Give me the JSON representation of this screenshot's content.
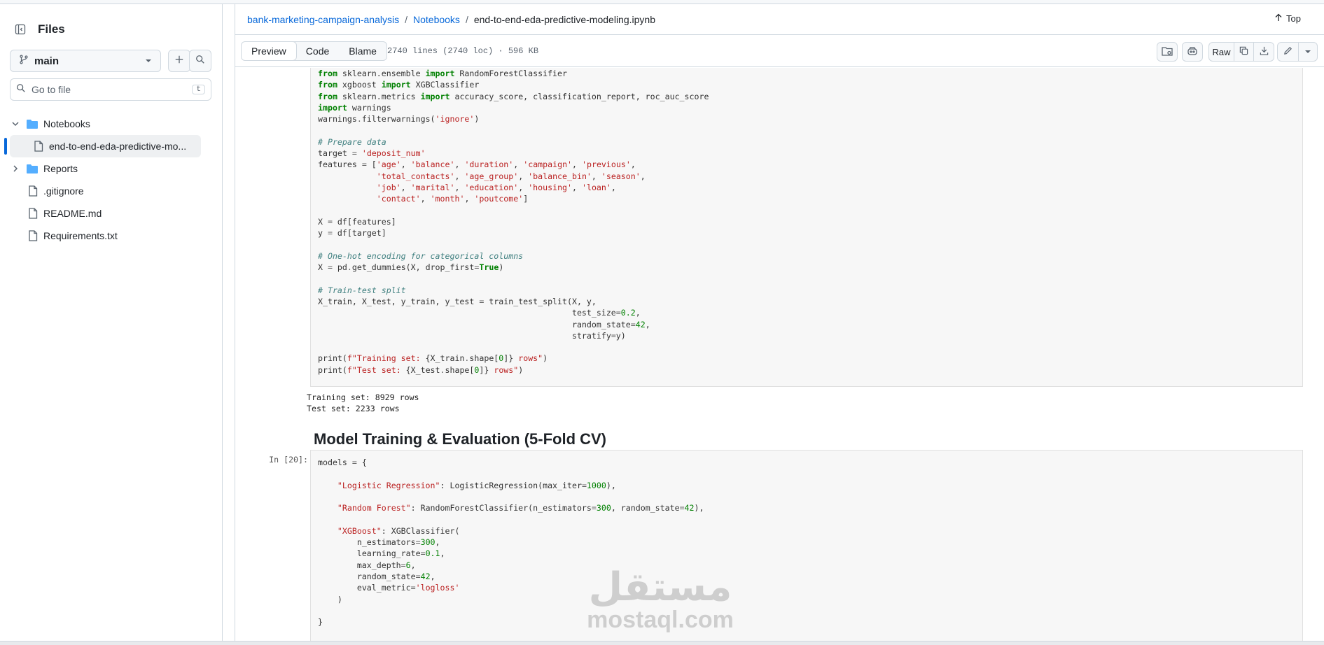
{
  "sidebar": {
    "title": "Files",
    "branch": "main",
    "search_placeholder": "Go to file",
    "search_shortcut": "t",
    "tree": [
      {
        "label": "Notebooks",
        "type": "folder",
        "expanded": true
      },
      {
        "label": "end-to-end-eda-predictive-mo...",
        "type": "file",
        "selected": true
      },
      {
        "label": "Reports",
        "type": "folder",
        "expanded": false
      },
      {
        "label": ".gitignore",
        "type": "file"
      },
      {
        "label": "README.md",
        "type": "file"
      },
      {
        "label": "Requirements.txt",
        "type": "file"
      }
    ]
  },
  "breadcrumb": {
    "repo": "bank-marketing-campaign-analysis",
    "folder": "Notebooks",
    "file": "end-to-end-eda-predictive-modeling.ipynb",
    "top_label": "Top"
  },
  "toolbar": {
    "tabs": [
      "Preview",
      "Code",
      "Blame"
    ],
    "active_tab": "Preview",
    "file_meta": "2740 lines (2740 loc) · 596 KB",
    "raw_label": "Raw"
  },
  "notebook": {
    "output_lines": [
      "Training set: 8929 rows",
      "Test set: 2233 rows"
    ],
    "heading": "Model Training & Evaluation (5-Fold CV)",
    "cell2_prompt": "In [20]:"
  },
  "watermark": {
    "arabic": "مستقل",
    "latin": "mostaql.com"
  },
  "colors": {
    "accent": "#0969da",
    "border": "#d1d9e0",
    "cell_bg": "#f7f7f7"
  }
}
